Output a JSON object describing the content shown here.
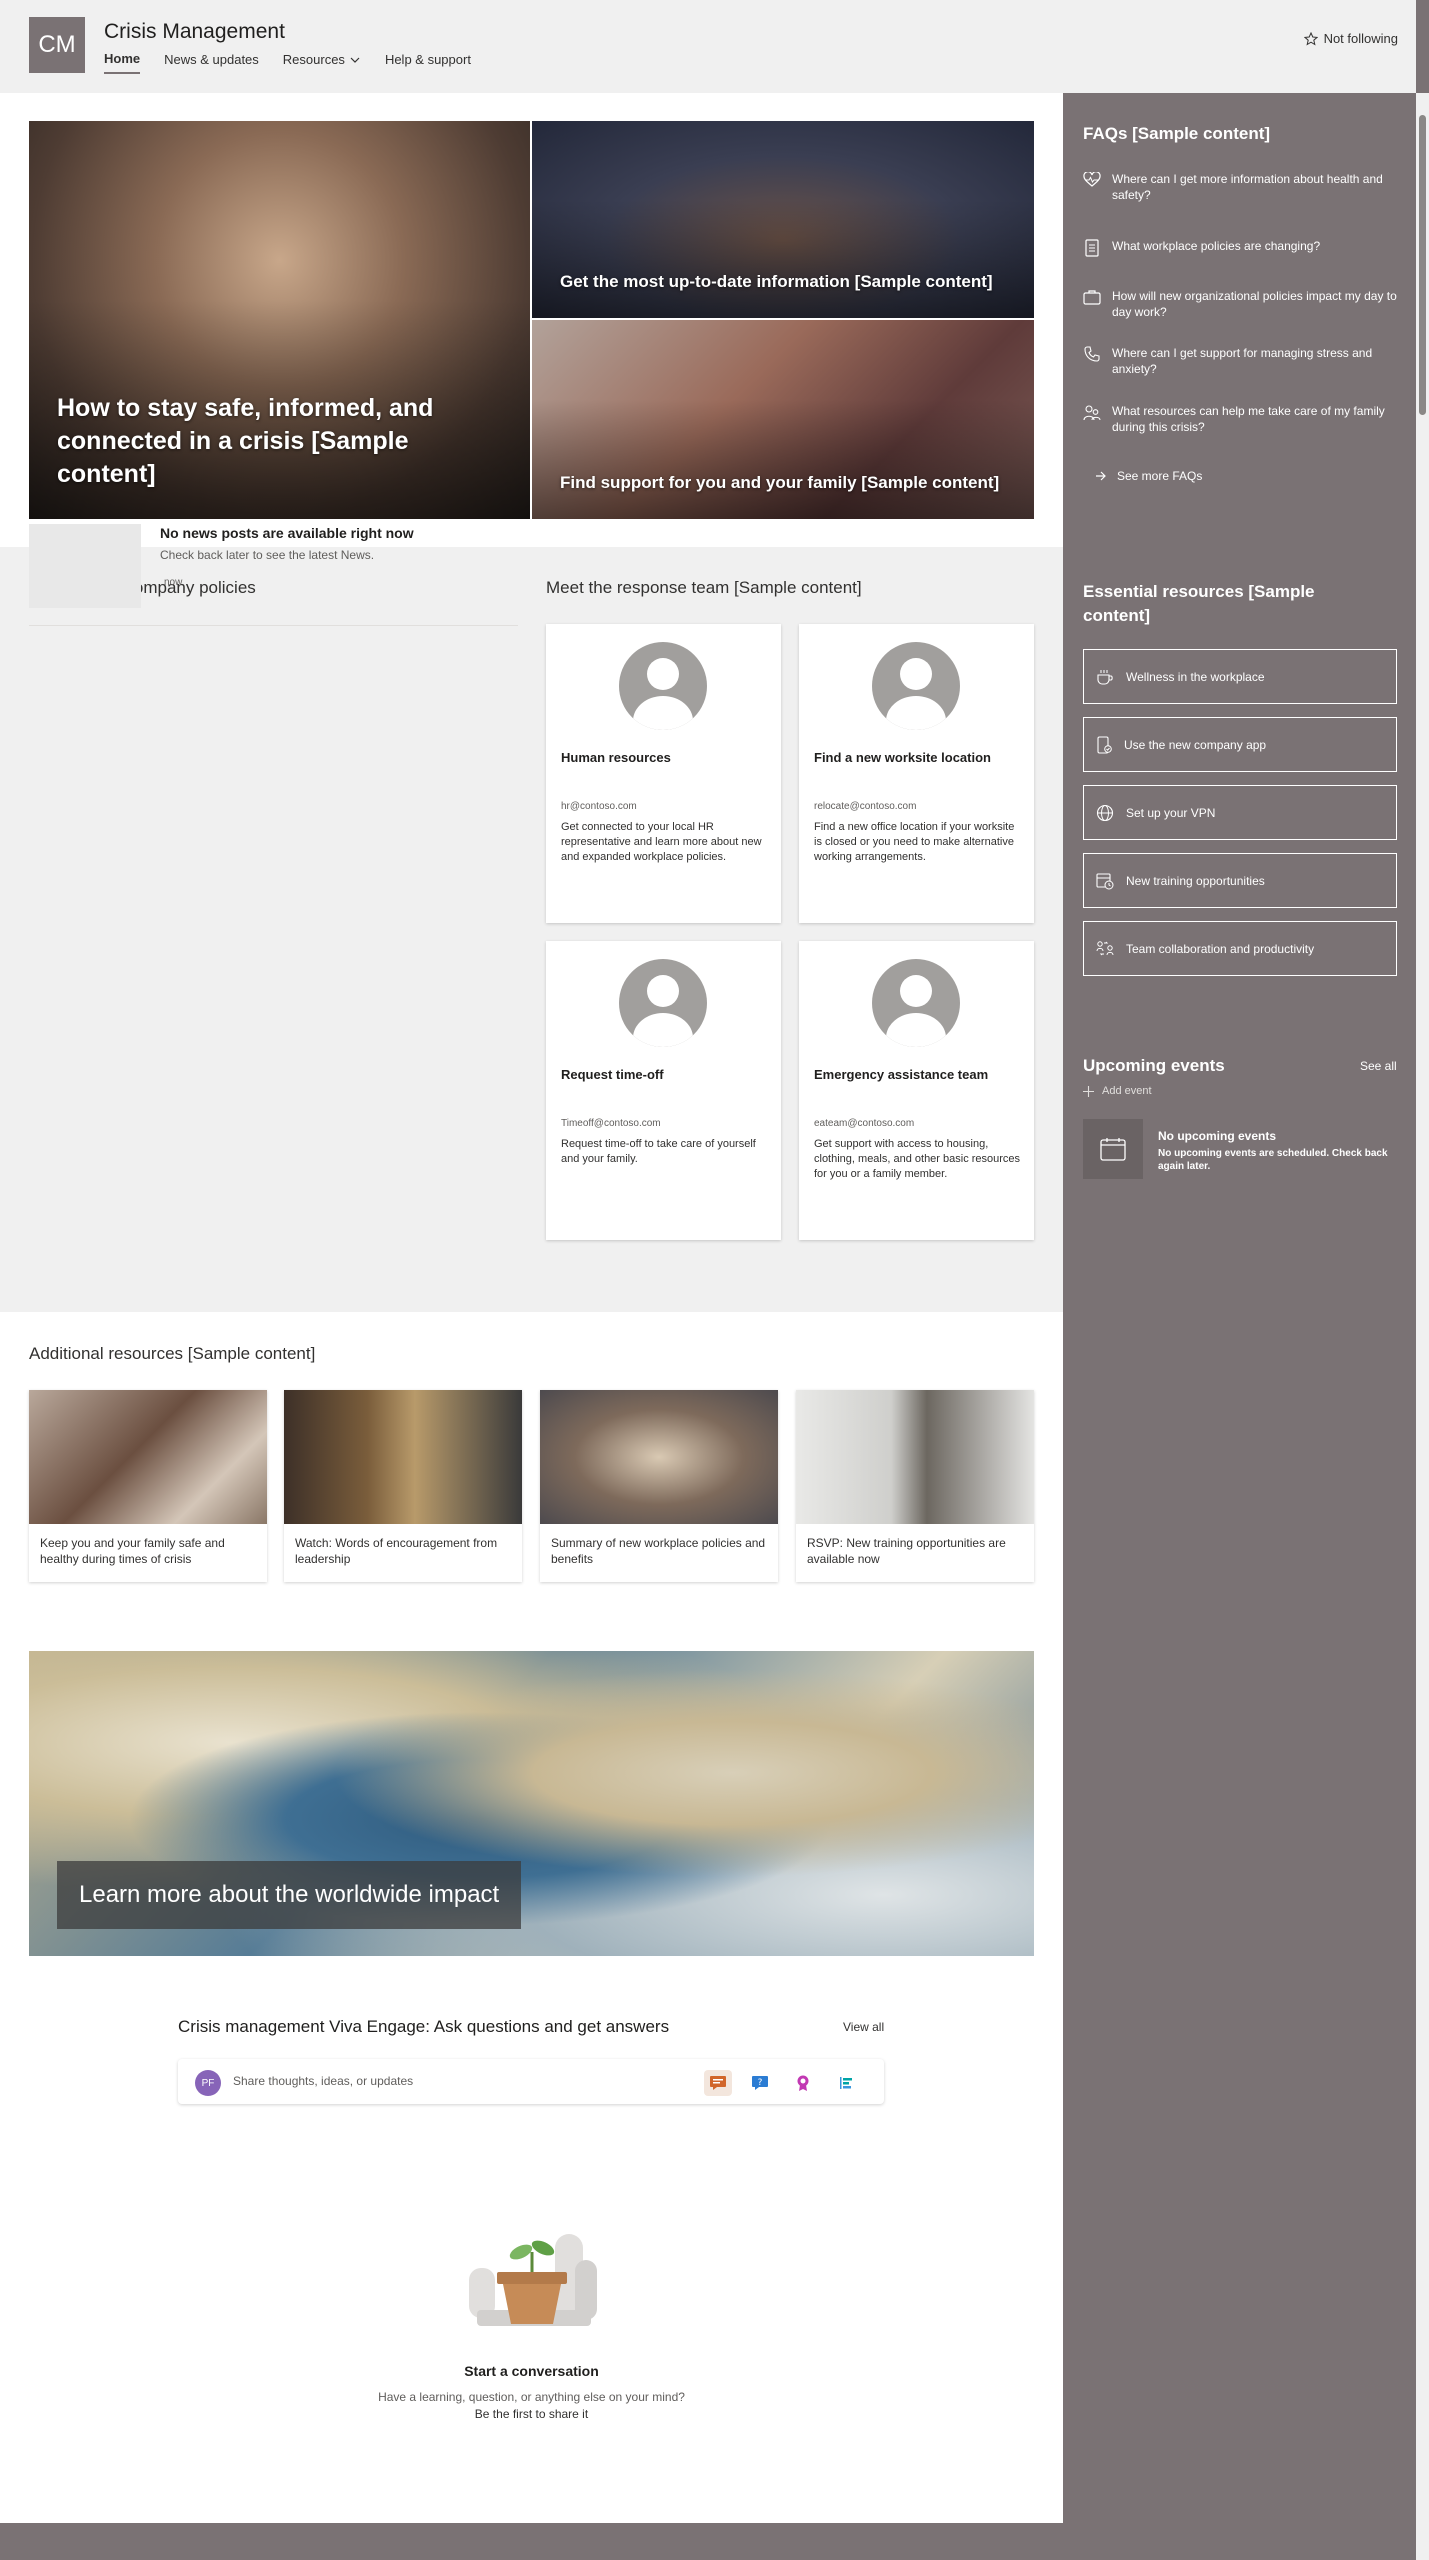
{
  "site": {
    "logo_text": "CM",
    "title": "Crisis Management"
  },
  "nav": {
    "items": [
      "Home",
      "News & updates",
      "Resources",
      "Help & support"
    ],
    "active": "Home"
  },
  "follow": {
    "label": "Not following"
  },
  "hero": {
    "main_caption": "How to stay safe, informed, and connected in a crisis [Sample content]",
    "top_right_caption": "Get the most up-to-date information [Sample content]",
    "bottom_right_caption": "Find support for you and your family [Sample content]"
  },
  "news": {
    "section_title": "Review new company policies",
    "empty_title": "No news posts are available right now",
    "empty_sub": "Check back later to see the latest News.",
    "time": "now"
  },
  "team": {
    "section_title": "Meet the response team [Sample content]",
    "members": [
      {
        "name": "Human resources",
        "email": "hr@contoso.com",
        "desc": "Get connected to your local HR representative and learn more about new and expanded workplace policies."
      },
      {
        "name": "Find a new worksite location",
        "email": "relocate@contoso.com",
        "desc": "Find a new office location if your worksite is closed or you need to make alternative working arrangements."
      },
      {
        "name": "Request time-off",
        "email": "Timeoff@contoso.com",
        "desc": "Request time-off to take care of yourself and your family."
      },
      {
        "name": "Emergency assistance team",
        "email": "eateam@contoso.com",
        "desc": "Get support with access to housing, clothing, meals, and other basic resources for you or a family member."
      }
    ]
  },
  "additional": {
    "section_title": "Additional resources [Sample content]",
    "items": [
      "Keep you and your family safe and healthy during times of crisis",
      "Watch: Words of encouragement from leadership",
      "Summary of new workplace policies and benefits",
      "RSVP: New training opportunities are available now"
    ]
  },
  "world": {
    "caption": "Learn more about the worldwide impact"
  },
  "viva": {
    "title": "Crisis management Viva Engage: Ask questions and get answers",
    "view_all": "View all",
    "avatar": "PF",
    "placeholder": "Share thoughts, ideas, or updates",
    "start_title": "Start a conversation",
    "start_line1": "Have a learning, question, or anything else on your mind?",
    "start_line2": "Be the first to share it"
  },
  "faq": {
    "title": "FAQs [Sample content]",
    "items": [
      {
        "icon": "heart-pulse-icon",
        "text": "Where can I get more information about health and safety?"
      },
      {
        "icon": "document-icon",
        "text": "What workplace policies are changing?"
      },
      {
        "icon": "briefcase-icon",
        "text": "How will new organizational policies impact my day to day work?"
      },
      {
        "icon": "phone-icon",
        "text": "Where can I get support for managing stress and anxiety?"
      },
      {
        "icon": "people-icon",
        "text": "What resources can help me take care of my family during this crisis?"
      }
    ],
    "see_more": "See more FAQs"
  },
  "essential": {
    "title": "Essential resources [Sample content]",
    "items": [
      {
        "icon": "coffee-icon",
        "label": "Wellness in the workplace"
      },
      {
        "icon": "mobile-app-icon",
        "label": "Use the new company app"
      },
      {
        "icon": "globe-icon",
        "label": "Set up your VPN"
      },
      {
        "icon": "training-icon",
        "label": "New training opportunities"
      },
      {
        "icon": "collaboration-icon",
        "label": "Team collaboration and productivity"
      }
    ]
  },
  "events": {
    "title": "Upcoming events",
    "see_all": "See all",
    "add": "Add event",
    "empty_title": "No upcoming events",
    "empty_sub": "No upcoming events are scheduled. Check back again later."
  },
  "colors": {
    "accent": "#7a7274",
    "band": "#f0f0f0"
  }
}
